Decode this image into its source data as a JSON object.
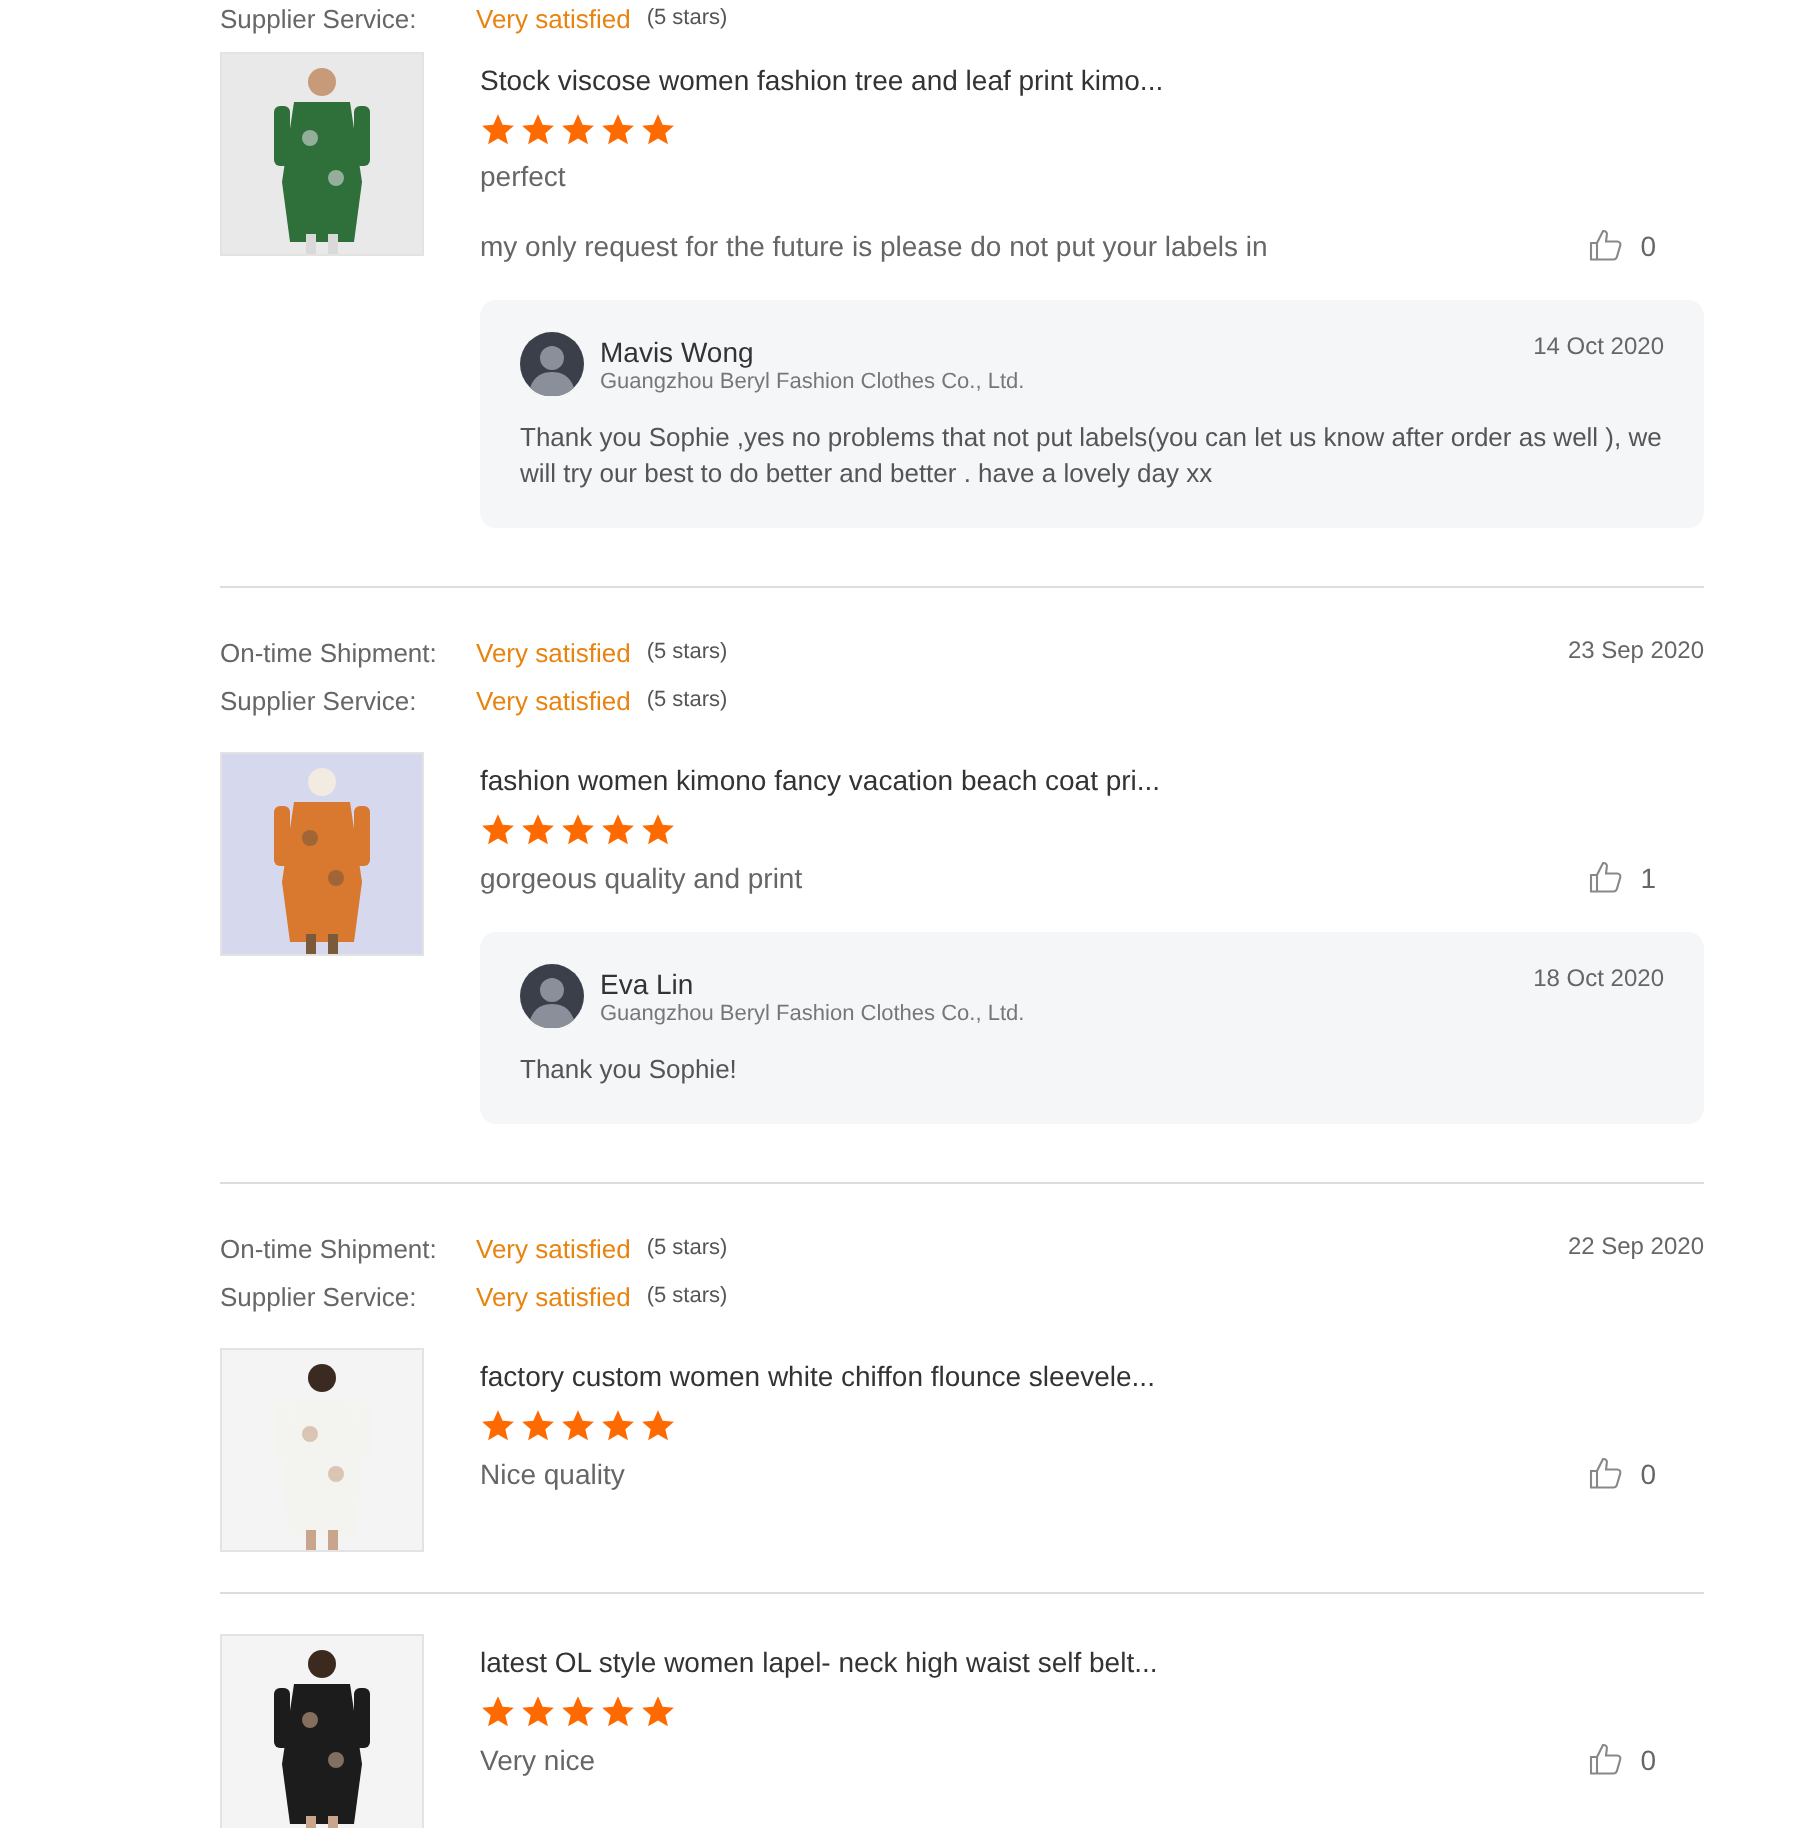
{
  "reviews": [
    {
      "ratings": [
        {
          "label": "Supplier Service:",
          "value": "Very satisfied",
          "stars": "(5 stars)"
        }
      ],
      "products": [
        {
          "title": "Stock viscose women fashion tree and leaf print kimo...",
          "stars": 5,
          "comment": "perfect",
          "followup": "my only request for the future is please do not put your labels in",
          "likes": "0",
          "reply": {
            "name": "Mavis Wong",
            "company": "Guangzhou Beryl Fashion Clothes Co., Ltd.",
            "date": "14 Oct 2020",
            "text": "Thank you Sophie ,yes no problems that not put labels(you can let us know after order as well ), we will try our best to do better and better . have a lovely day xx"
          }
        }
      ]
    },
    {
      "date": "23 Sep 2020",
      "ratings": [
        {
          "label": "On-time Shipment:",
          "value": "Very satisfied",
          "stars": "(5 stars)"
        },
        {
          "label": "Supplier Service:",
          "value": "Very satisfied",
          "stars": "(5 stars)"
        }
      ],
      "products": [
        {
          "title": "fashion women kimono fancy vacation beach coat pri...",
          "stars": 5,
          "comment": "gorgeous quality and print",
          "likes": "1",
          "reply": {
            "name": "Eva Lin",
            "company": "Guangzhou Beryl Fashion Clothes Co., Ltd.",
            "date": "18 Oct 2020",
            "text": "Thank you Sophie!"
          }
        }
      ]
    },
    {
      "date": "22 Sep 2020",
      "ratings": [
        {
          "label": "On-time Shipment:",
          "value": "Very satisfied",
          "stars": "(5 stars)"
        },
        {
          "label": "Supplier Service:",
          "value": "Very satisfied",
          "stars": "(5 stars)"
        }
      ],
      "products": [
        {
          "title": "factory custom women white chiffon flounce sleevele...",
          "stars": 5,
          "comment": "Nice quality",
          "likes": "0"
        },
        {
          "title": "latest OL style women lapel- neck high waist self belt...",
          "stars": 5,
          "comment": "Very nice",
          "likes": "0"
        }
      ]
    }
  ]
}
